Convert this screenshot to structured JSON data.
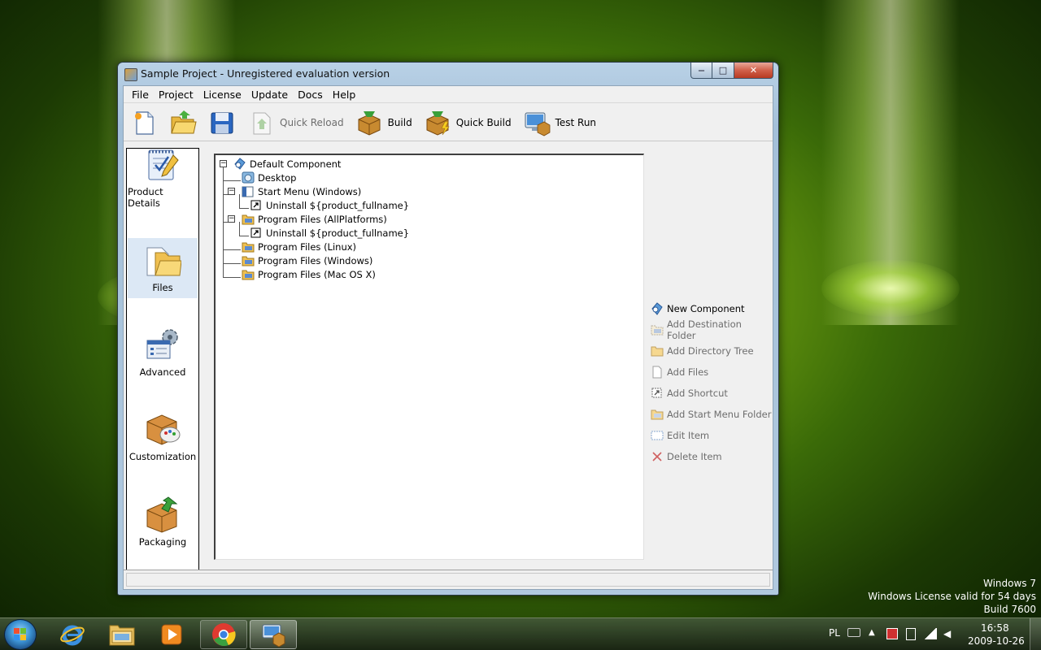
{
  "window": {
    "title": "Sample Project - Unregistered evaluation version",
    "caption": {
      "minimize": "—",
      "maximize": "□",
      "close": "✕"
    }
  },
  "menu": [
    "File",
    "Project",
    "License",
    "Update",
    "Docs",
    "Help"
  ],
  "toolbar": {
    "new_icon": "new-document-icon",
    "open_icon": "open-folder-icon",
    "save_icon": "save-disk-icon",
    "quick_reload": "Quick Reload",
    "build": "Build",
    "quick_build": "Quick Build",
    "test_run": "Test Run"
  },
  "nav": [
    {
      "label": "Product Details",
      "icon": "product-details-icon"
    },
    {
      "label": "Files",
      "icon": "files-icon",
      "selected": true
    },
    {
      "label": "Advanced",
      "icon": "advanced-icon"
    },
    {
      "label": "Customization",
      "icon": "customization-icon"
    },
    {
      "label": "Packaging",
      "icon": "packaging-icon"
    }
  ],
  "tree": [
    {
      "label": "Default Component",
      "icon": "component-icon"
    },
    {
      "label": "Desktop",
      "icon": "desktop-icon"
    },
    {
      "label": "Start Menu (Windows)",
      "icon": "start-menu-icon"
    },
    {
      "label": "Uninstall ${product_fullname}",
      "icon": "shortcut-icon"
    },
    {
      "label": "Program Files (AllPlatforms)",
      "icon": "folder-icon"
    },
    {
      "label": "Uninstall ${product_fullname}",
      "icon": "shortcut-icon"
    },
    {
      "label": "Program Files (Linux)",
      "icon": "folder-icon"
    },
    {
      "label": "Program Files (Windows)",
      "icon": "folder-icon"
    },
    {
      "label": "Program Files (Mac OS X)",
      "icon": "folder-icon"
    }
  ],
  "actions": [
    {
      "label": "New Component",
      "enabled": true,
      "icon": "new-component-icon"
    },
    {
      "label": "Add Destination Folder",
      "enabled": false,
      "icon": "destination-folder-icon"
    },
    {
      "label": "Add Directory Tree",
      "enabled": false,
      "icon": "directory-tree-icon"
    },
    {
      "label": "Add Files",
      "enabled": false,
      "icon": "add-files-icon"
    },
    {
      "label": "Add Shortcut",
      "enabled": false,
      "icon": "add-shortcut-icon"
    },
    {
      "label": "Add Start Menu Folder",
      "enabled": false,
      "icon": "start-menu-folder-icon"
    },
    {
      "label": "Edit Item",
      "enabled": false,
      "icon": "edit-item-icon"
    },
    {
      "label": "Delete Item",
      "enabled": false,
      "icon": "delete-item-icon"
    }
  ],
  "watermark": {
    "line1": "Windows 7",
    "line2": "Windows License valid for 54 days",
    "line3": "Build 7600"
  },
  "taskbar": {
    "apps": [
      "internet-explorer-icon",
      "windows-explorer-icon",
      "media-player-icon",
      "chrome-icon",
      "installer-app-icon"
    ],
    "language": "PL",
    "time": "16:58",
    "date": "2009-10-26"
  },
  "colors": {
    "desktop_green": "#6fa010",
    "window_frame": "#a4c0d9",
    "close_red": "#c84a30",
    "selection": "#dce8f5"
  }
}
